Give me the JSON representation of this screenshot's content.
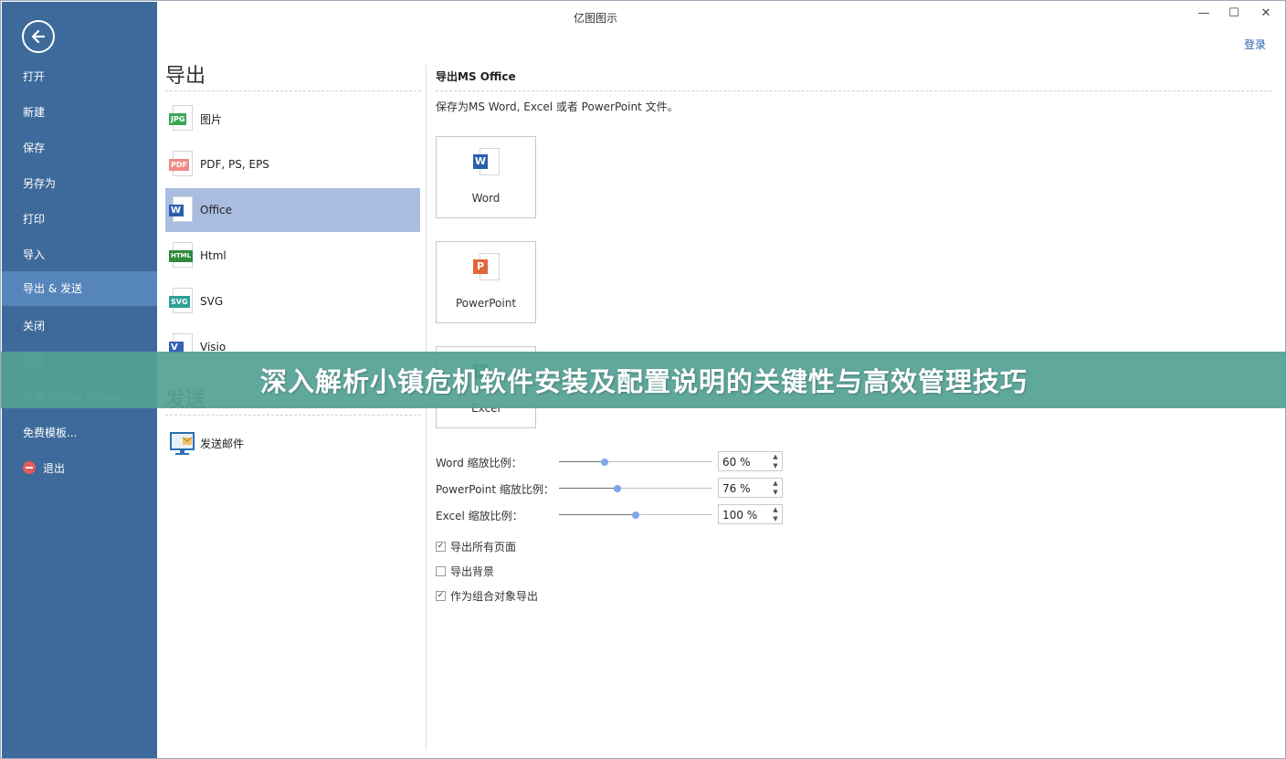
{
  "window": {
    "title": "亿图图示",
    "login": "登录",
    "minimize": "—",
    "maximize": "☐",
    "close": "✕"
  },
  "sidebar": {
    "items": [
      {
        "label": "打开"
      },
      {
        "label": "新建"
      },
      {
        "label": "保存"
      },
      {
        "label": "另存为"
      },
      {
        "label": "打印"
      },
      {
        "label": "导入"
      },
      {
        "label": "导出 & 发送"
      },
      {
        "label": "关闭"
      },
      {
        "label": "选项"
      },
      {
        "label": "免费 Edraw Viewer"
      },
      {
        "label": "免费模板..."
      },
      {
        "label": "退出"
      }
    ]
  },
  "export_section": {
    "title": "导出",
    "items": [
      {
        "label": "图片",
        "tag": "JPG",
        "color": "#3aa757"
      },
      {
        "label": "PDF, PS, EPS",
        "tag": "PDF",
        "color": "#f08a84"
      },
      {
        "label": "Office",
        "tag": "W",
        "color": "#2b5fad"
      },
      {
        "label": "Html",
        "tag": "HTML",
        "color": "#2e8b3c"
      },
      {
        "label": "SVG",
        "tag": "SVG",
        "color": "#2aa198"
      },
      {
        "label": "Visio",
        "tag": "V",
        "color": "#3560b5"
      }
    ]
  },
  "send_section": {
    "title": "发送",
    "items": [
      {
        "label": "发送邮件"
      }
    ]
  },
  "panel": {
    "title": "导出MS Office",
    "description": "保存为MS Word, Excel 或者 PowerPoint 文件。",
    "buttons": [
      {
        "label": "Word",
        "letter": "W",
        "color": "#2b5fad"
      },
      {
        "label": "PowerPoint",
        "letter": "P",
        "color": "#e0673c"
      },
      {
        "label": "Excel",
        "letter": "X",
        "color": "#1e7a45"
      }
    ],
    "zoom": [
      {
        "label": "Word 缩放比例：",
        "value": "60 %",
        "level": 30
      },
      {
        "label": "PowerPoint 缩放比例：",
        "value": "76 %",
        "level": 38
      },
      {
        "label": "Excel 缩放比例：",
        "value": "100 %",
        "level": 50
      }
    ],
    "checkboxes": [
      {
        "label": "导出所有页面",
        "checked": true
      },
      {
        "label": "导出背景",
        "checked": false
      },
      {
        "label": "作为组合对象导出",
        "checked": true
      }
    ]
  },
  "banner": {
    "text": "深入解析小镇危机软件安装及配置说明的关键性与高效管理技巧"
  }
}
